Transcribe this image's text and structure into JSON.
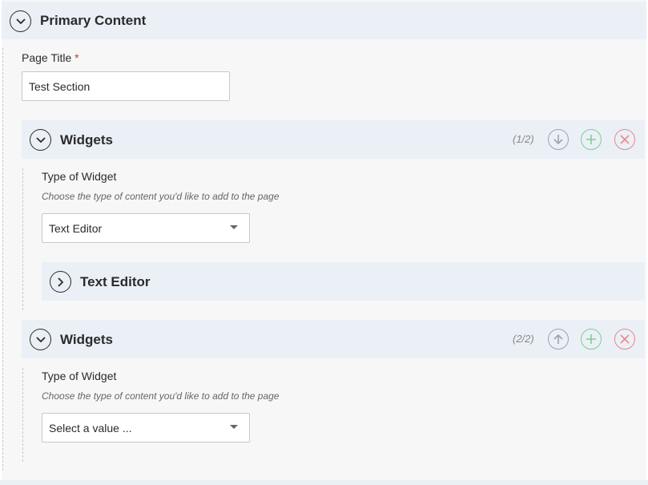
{
  "primary": {
    "title": "Primary Content"
  },
  "page_title_field": {
    "label": "Page Title",
    "required_mark": "*",
    "value": "Test Section"
  },
  "widgets": [
    {
      "title": "Widgets",
      "counter": "(1/2)",
      "type_label": "Type of Widget",
      "help_text": "Choose the type of content you'd like to add to the page",
      "selected": "Text Editor",
      "subsection": {
        "title": "Text Editor"
      }
    },
    {
      "title": "Widgets",
      "counter": "(2/2)",
      "type_label": "Type of Widget",
      "help_text": "Choose the type of content you'd like to add to the page",
      "selected": "Select a value ..."
    }
  ],
  "icons": {
    "collapse": "chevron-down-icon",
    "expand": "chevron-right-icon",
    "move_down": "arrow-down-icon",
    "move_up": "arrow-up-icon",
    "add": "plus-icon",
    "remove": "close-icon"
  },
  "colors": {
    "required": "#d0312d",
    "add": "#7fcf8f",
    "remove": "#e88a8a",
    "move": "#9aa4b0",
    "header_bg": "#eaf0f6"
  }
}
